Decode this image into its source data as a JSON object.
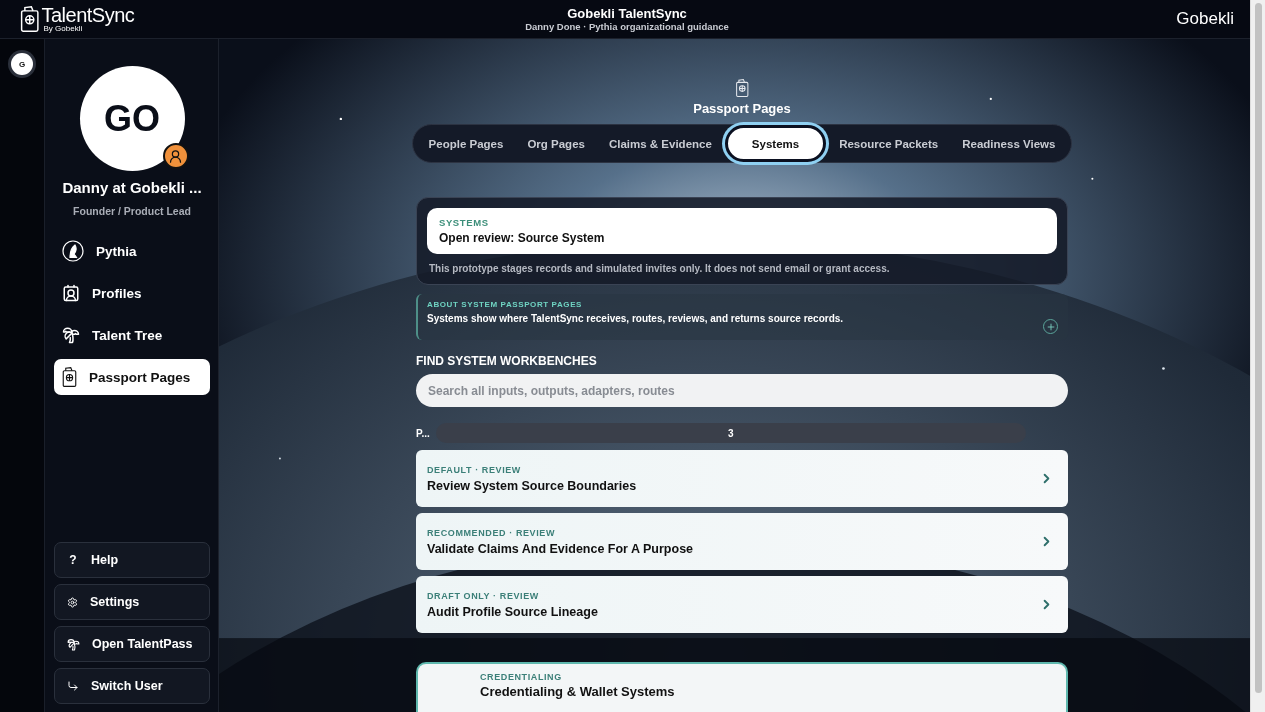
{
  "header": {
    "brand": "TalentSync",
    "brand_sub": "By Gobekli",
    "title": "Gobekli TalentSync",
    "subtitle": "Danny Done · Pythia organizational guidance",
    "org": "Gobekli"
  },
  "rail": {
    "avatar": "G"
  },
  "profile": {
    "initials": "GO",
    "name": "Danny at Gobekli ...",
    "role": "Founder / Product Lead"
  },
  "nav": [
    {
      "label": "Pythia",
      "kind": "pythia",
      "selected": false
    },
    {
      "label": "Profiles",
      "kind": "profiles",
      "selected": false
    },
    {
      "label": "Talent Tree",
      "kind": "tree",
      "selected": false
    },
    {
      "label": "Passport Pages",
      "kind": "passport",
      "selected": true
    }
  ],
  "footer_buttons": [
    {
      "label": "Help",
      "kind": "help",
      "glyph": "?"
    },
    {
      "label": "Settings",
      "kind": "settings"
    },
    {
      "label": "Open TalentPass",
      "kind": "tree"
    },
    {
      "label": "Switch User",
      "kind": "switch"
    }
  ],
  "page": {
    "title": "Passport Pages",
    "tabs": [
      {
        "label": "People Pages",
        "selected": false
      },
      {
        "label": "Org Pages",
        "selected": false
      },
      {
        "label": "Claims & Evidence",
        "selected": false
      },
      {
        "label": "Systems",
        "selected": true
      },
      {
        "label": "Resource Packets",
        "selected": false
      },
      {
        "label": "Readiness Views",
        "selected": false
      }
    ],
    "notice": {
      "eyebrow": "SYSTEMS",
      "title": "Open review: Source System",
      "note": "This prototype stages records and simulated invites only. It does not send email or grant access."
    },
    "about": {
      "eyebrow": "ABOUT SYSTEM PASSPORT PAGES",
      "text": "Systems show where TalentSync receives, routes, reviews, and returns source records.",
      "expanded": false
    },
    "search": {
      "heading": "FIND SYSTEM WORKBENCHES",
      "placeholder": "Search all inputs, outputs, adapters, routes"
    },
    "pager": {
      "label": "P...",
      "value": "3"
    },
    "workbenches": [
      {
        "tag": "DEFAULT · REVIEW",
        "title": "Review System Source Boundaries"
      },
      {
        "tag": "RECOMMENDED · REVIEW",
        "title": "Validate Claims And Evidence For A Purpose"
      },
      {
        "tag": "DRAFT ONLY · REVIEW",
        "title": "Audit Profile Source Lineage"
      }
    ],
    "section": {
      "eyebrow": "CREDENTIALING",
      "title": "Credentialing & Wallet Systems"
    }
  }
}
